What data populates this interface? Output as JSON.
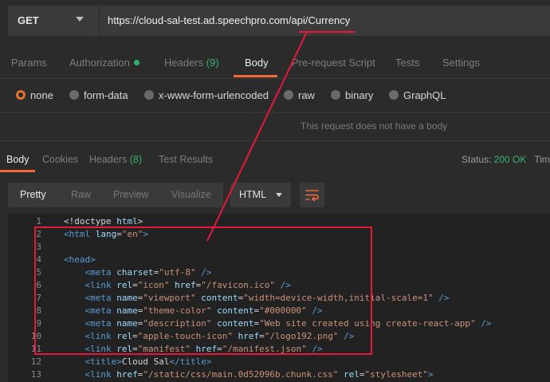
{
  "request": {
    "method": "GET",
    "url": "https://cloud-sal-test.ad.speechpro.com/api/Currency"
  },
  "request_tabs": [
    {
      "label": "Params"
    },
    {
      "label": "Authorization"
    },
    {
      "label": "Headers",
      "count": "(9)"
    },
    {
      "label": "Body"
    },
    {
      "label": "Pre-request Script"
    },
    {
      "label": "Tests"
    },
    {
      "label": "Settings"
    }
  ],
  "body_types": [
    "none",
    "form-data",
    "x-www-form-urlencoded",
    "raw",
    "binary",
    "GraphQL"
  ],
  "body_type_selected": "none",
  "no_body_text": "This request does not have a body",
  "response_tabs": [
    {
      "label": "Body"
    },
    {
      "label": "Cookies"
    },
    {
      "label": "Headers",
      "count": "(8)"
    },
    {
      "label": "Test Results"
    }
  ],
  "status": {
    "label": "Status:",
    "value": "200 OK",
    "next": "Tim"
  },
  "view_modes": [
    "Pretty",
    "Raw",
    "Preview",
    "Visualize"
  ],
  "language": "HTML",
  "code_lines": [
    {
      "n": "1",
      "text": "<!doctype html>"
    },
    {
      "n": "2",
      "text": "<html lang=\"en\">"
    },
    {
      "n": "3",
      "text": ""
    },
    {
      "n": "4",
      "text": "<head>"
    },
    {
      "n": "5",
      "text": "    <meta charset=\"utf-8\" />"
    },
    {
      "n": "6",
      "text": "    <link rel=\"icon\" href=\"/favicon.ico\" />"
    },
    {
      "n": "7",
      "text": "    <meta name=\"viewport\" content=\"width=device-width,initial-scale=1\" />"
    },
    {
      "n": "8",
      "text": "    <meta name=\"theme-color\" content=\"#000000\" />"
    },
    {
      "n": "9",
      "text": "    <meta name=\"description\" content=\"Web site created using create-react-app\" />"
    },
    {
      "n": "10",
      "text": "    <link rel=\"apple-touch-icon\" href=\"/logo192.png\" />"
    },
    {
      "n": "11",
      "text": "    <link rel=\"manifest\" href=\"/manifest.json\" />"
    },
    {
      "n": "12",
      "text": "    <title>Cloud Sal</title>"
    },
    {
      "n": "13",
      "text": "    <link href=\"/static/css/main.0d52096b.chunk.css\" rel=\"stylesheet\">"
    }
  ],
  "colors": {
    "accent": "#f26b3a",
    "annotation": "#e8183a",
    "status_ok": "#3cb371"
  }
}
